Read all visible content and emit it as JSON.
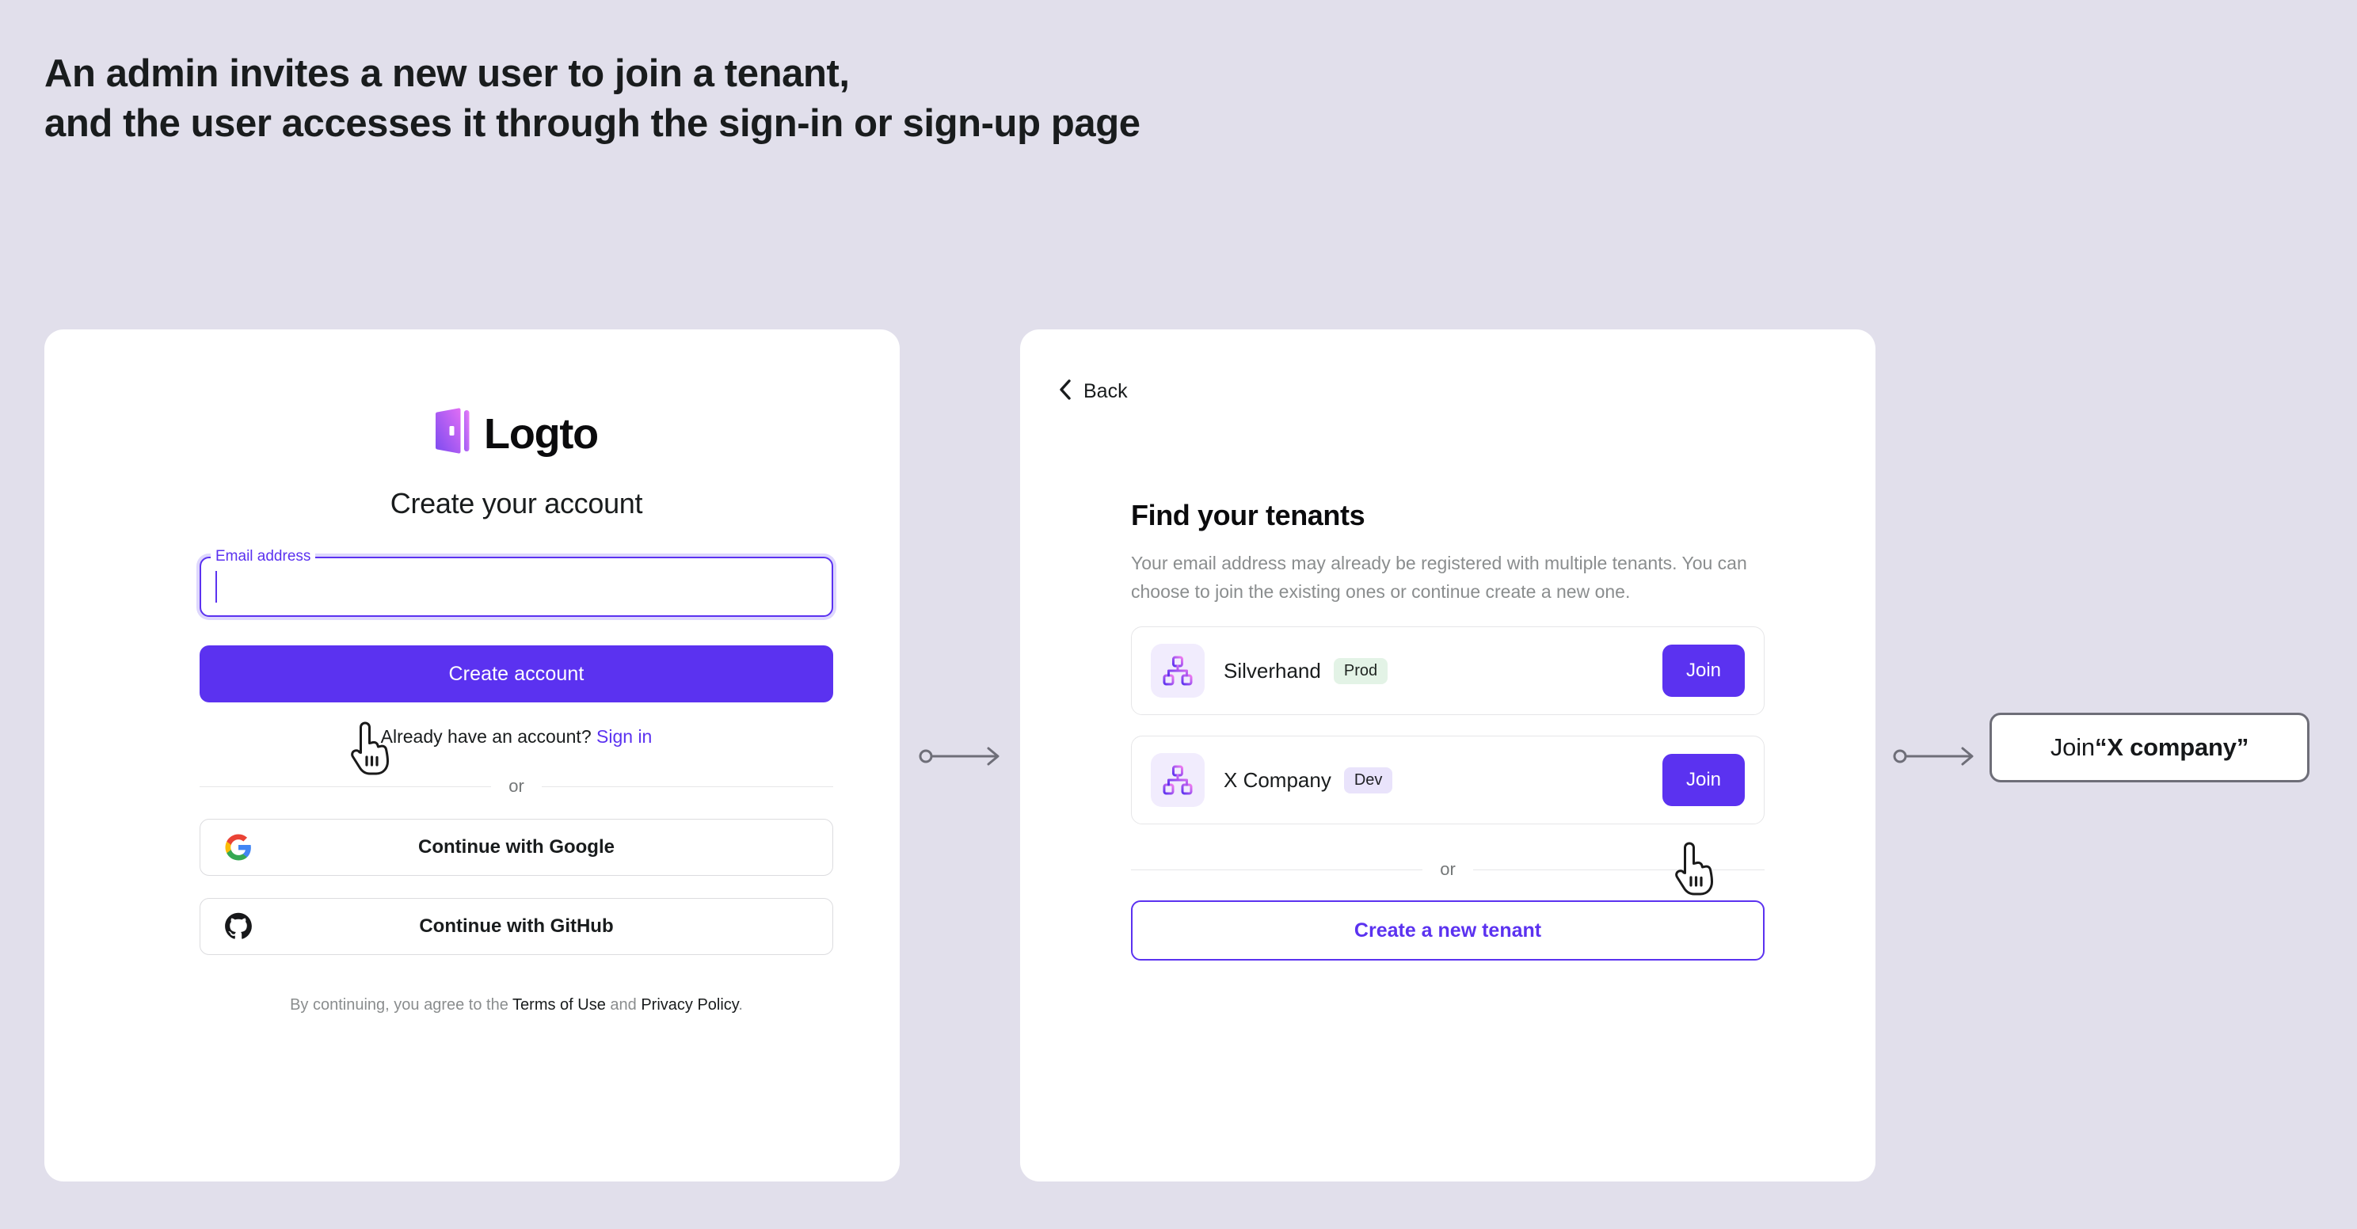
{
  "page": {
    "background_color": "#e1dfeb",
    "accent_color": "#5b32f0",
    "heading_line_1": "An admin invites a new user to join a tenant,",
    "heading_line_2": "and the user accesses it through the sign-in or sign-up page"
  },
  "signup_card": {
    "logo_icon": "logto-door-icon",
    "logo_text": "Logto",
    "title": "Create your account",
    "email_field": {
      "label": "Email address",
      "value": "",
      "placeholder": "",
      "focused": true
    },
    "primary_button": "Create account",
    "signin_prompt": "Already have an account?",
    "signin_link": "Sign in",
    "divider_text": "or",
    "social_buttons": [
      {
        "icon": "google-icon",
        "label": "Continue with Google"
      },
      {
        "icon": "github-icon",
        "label": "Continue with GitHub"
      }
    ],
    "legal": {
      "prefix": "By continuing, you agree to the ",
      "terms_link": "Terms of Use",
      "middle": " and ",
      "privacy_link": "Privacy Policy",
      "suffix": "."
    }
  },
  "tenants_card": {
    "back_label": "Back",
    "back_icon": "chevron-left-icon",
    "title": "Find your tenants",
    "description": "Your email address may already be registered with multiple tenants. You can choose to join the existing ones or continue create a new one.",
    "tenants": [
      {
        "icon": "org-chart-icon",
        "name": "Silverhand",
        "badge": "Prod",
        "badge_type": "prod",
        "badge_bg": "#e3f3e6",
        "action_label": "Join"
      },
      {
        "icon": "org-chart-icon",
        "name": "X Company",
        "badge": "Dev",
        "badge_type": "dev",
        "badge_bg": "#e9e3fb",
        "action_label": "Join"
      }
    ],
    "divider_text": "or",
    "create_button": "Create a new tenant"
  },
  "result_node": {
    "prefix": "Join ",
    "quoted": "“X company”"
  },
  "connectors": [
    {
      "name": "connector-signup-to-tenants",
      "icon": "arrow-right-icon"
    },
    {
      "name": "connector-tenants-to-result",
      "icon": "arrow-right-icon"
    }
  ],
  "cursors": [
    {
      "name": "pointer-cursor-create-account",
      "icon": "pointing-hand-cursor"
    },
    {
      "name": "pointer-cursor-join-x-company",
      "icon": "pointing-hand-cursor"
    }
  ]
}
